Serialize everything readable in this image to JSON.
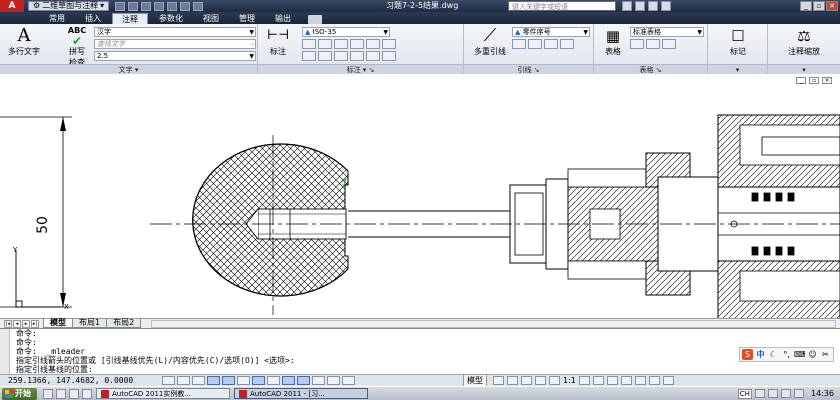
{
  "titlebar": {
    "app_logo": "A",
    "workspace": "二维草图与注释",
    "document_title": "习题7-2-5结果.dwg",
    "search_placeholder": "键入关键字或短语",
    "window_buttons": [
      "_",
      "▫",
      "✕"
    ]
  },
  "ribbon_tabs": [
    "常用",
    "插入",
    "注释",
    "参数化",
    "视图",
    "管理",
    "输出"
  ],
  "active_tab": "注释",
  "ribbon": {
    "text_panel": {
      "title": "文字",
      "mtext_label": "多行文字",
      "spell_abc": "ABC",
      "spell_label_1": "拼写",
      "spell_label_2": "检查",
      "font_style": "汉字",
      "find_text_placeholder": "查找文字",
      "text_height": "2.5"
    },
    "dim_panel": {
      "title": "标注",
      "dim_label": "标注",
      "dim_style": "ISO-35"
    },
    "leader_panel": {
      "title": "引线",
      "multileader_label": "多重引线",
      "leader_style": "零件序号"
    },
    "table_panel": {
      "title": "表格",
      "table_label": "表格",
      "table_style": "标准表格"
    },
    "markup_panel": {
      "label": "标记"
    },
    "scale_panel": {
      "label": "注释缩放"
    }
  },
  "drawing": {
    "dimension_text": "50",
    "ucs_y": "Y",
    "ucs_x": "X"
  },
  "layout_tabs": [
    "模型",
    "布局1",
    "布局2"
  ],
  "active_layout": "模型",
  "command_history": [
    "命令:",
    "命令:",
    "命令:  _mleader",
    "指定引线箭头的位置或 [引线基线优先(L)/内容优先(C)/选项(O)] <选项>:",
    "指定引线基线的位置:"
  ],
  "ime": {
    "logo": "S",
    "mode": "中"
  },
  "status": {
    "coordinates": "259.1366, 147.4682, 0.0000",
    "model_label": "模型",
    "annotation_scale": "1:1"
  },
  "taskbar": {
    "start_label": "开始",
    "tasks": [
      "AutoCAD 2011实例教...",
      "AutoCAD 2011 - [习..."
    ],
    "active_task": 1,
    "lang": "CH",
    "clock": "14:36"
  }
}
